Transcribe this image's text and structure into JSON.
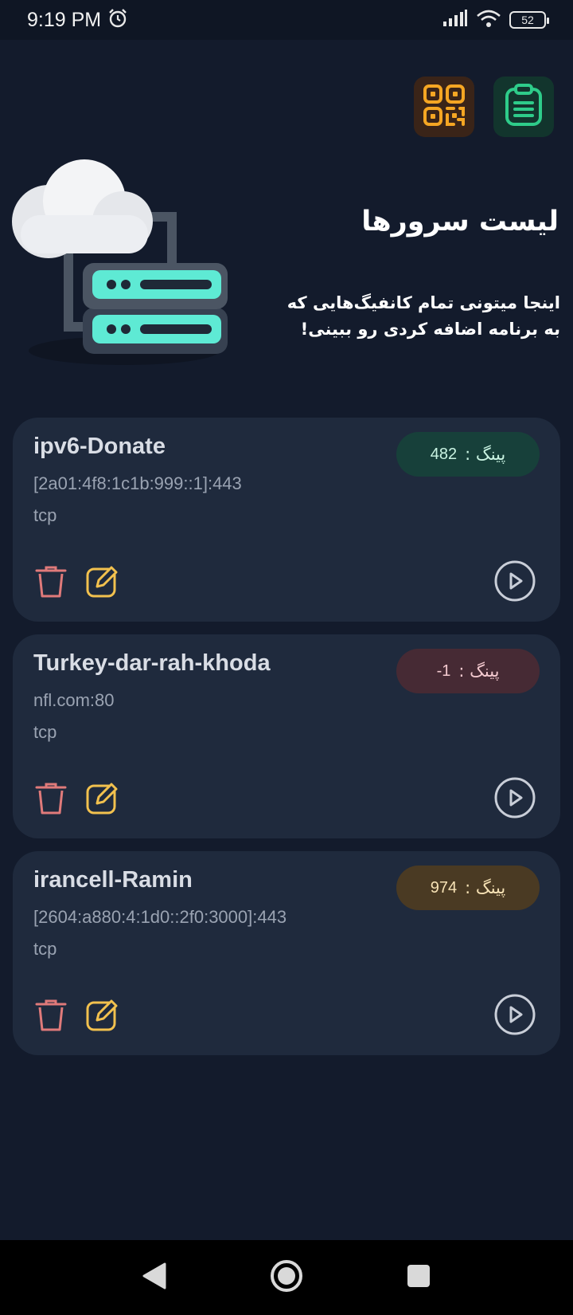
{
  "status_bar": {
    "time": "9:19 PM",
    "battery": "52",
    "icons": [
      "alarm-icon",
      "signal-icon",
      "wifi-icon",
      "battery-icon"
    ]
  },
  "toolbar": {
    "icons": [
      "qr-code-icon",
      "clipboard-icon"
    ],
    "colors": {
      "qr": "#f5a623",
      "clipboard": "#2ecc8a"
    }
  },
  "header": {
    "title": "لیست سرورها",
    "subtitle": "اینجا میتونی تمام کانفیگ‌هایی که به برنامه اضافه کردی رو ببینی!"
  },
  "servers": [
    {
      "name": "ipv6-Donate",
      "address": "[2a01:4f8:1c1b:999::1]:443",
      "protocol": "tcp",
      "ping_label": "پینگ :",
      "ping_value": "482",
      "ping_status": "good"
    },
    {
      "name": "Turkey-dar-rah-khoda",
      "address": "nfl.com:80",
      "protocol": "tcp",
      "ping_label": "پینگ :",
      "ping_value": "-1",
      "ping_status": "bad"
    },
    {
      "name": "irancell-Ramin",
      "address": "[2604:a880:4:1d0::2f0:3000]:443",
      "protocol": "tcp",
      "ping_label": "پینگ :",
      "ping_value": "974",
      "ping_status": "mid"
    }
  ],
  "card_icons": [
    "trash-icon",
    "edit-icon",
    "play-icon"
  ],
  "nav_bar": {
    "icons": [
      "back-icon",
      "home-icon",
      "recents-icon"
    ]
  },
  "colors": {
    "background": "#131b2c",
    "card": "#1f2a3d",
    "trash": "#e07a7a",
    "edit": "#f2c14e",
    "play": "#c9ced8"
  }
}
